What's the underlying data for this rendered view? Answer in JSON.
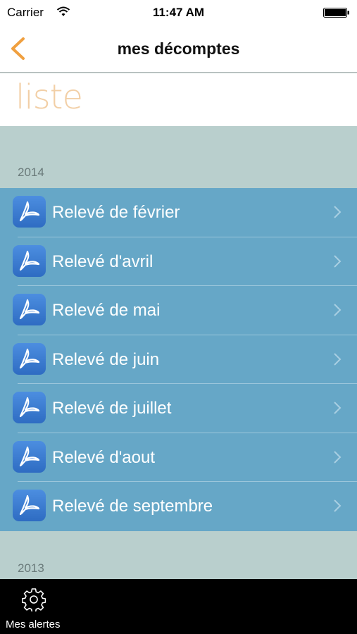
{
  "status_bar": {
    "carrier": "Carrier",
    "time": "11:47 AM"
  },
  "nav": {
    "title": "mes décomptes"
  },
  "section": {
    "title": "liste"
  },
  "groups": [
    {
      "year": "2014",
      "items": [
        {
          "label": "Relevé de février",
          "icon": "pdf-icon"
        },
        {
          "label": "Relevé d'avril",
          "icon": "pdf-icon"
        },
        {
          "label": "Relevé de mai",
          "icon": "pdf-icon"
        },
        {
          "label": "Relevé de juin",
          "icon": "pdf-icon"
        },
        {
          "label": "Relevé de juillet",
          "icon": "pdf-icon"
        },
        {
          "label": "Relevé d'aout",
          "icon": "pdf-icon"
        },
        {
          "label": "Relevé de septembre",
          "icon": "pdf-icon"
        }
      ]
    },
    {
      "year": "2013",
      "items": []
    }
  ],
  "tab_bar": {
    "items": [
      {
        "label": "Mes alertes",
        "icon": "gear-icon"
      }
    ]
  },
  "colors": {
    "accent": "#f0a040",
    "row_bg": "#66a7c7",
    "background": "#b9cfcd",
    "title_accent": "#f2cfa6"
  }
}
